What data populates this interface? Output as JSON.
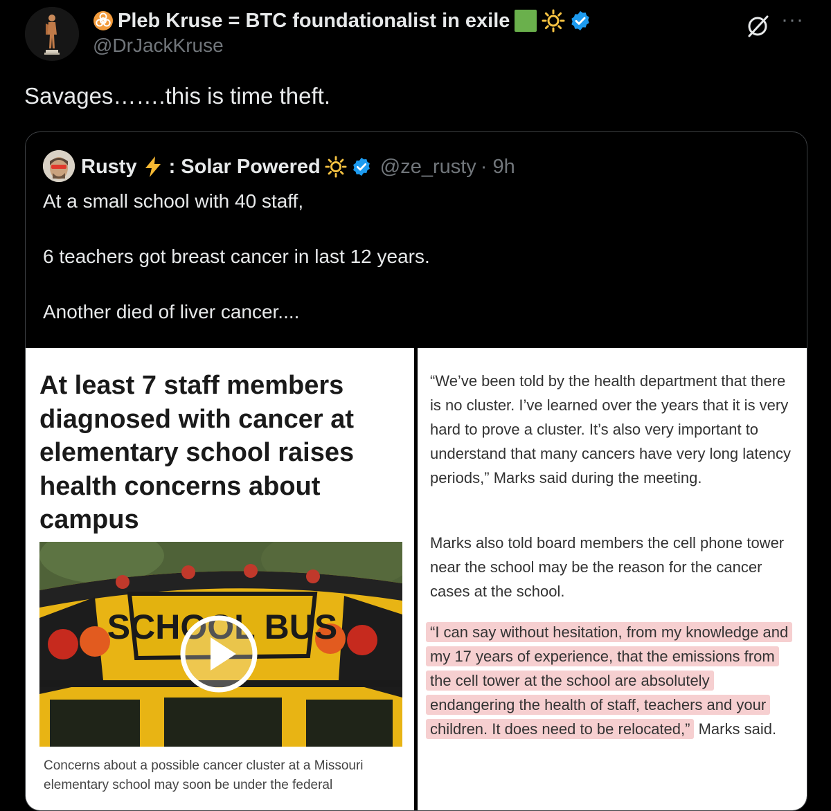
{
  "author": {
    "display_name": "Pleb Kruse = BTC foundationalist in exile",
    "handle": "@DrJackKruse",
    "emoji_icons": [
      "biohazard-icon",
      "green-square-icon",
      "sun-icon"
    ],
    "verified": true
  },
  "tweet": {
    "text": "Savages…….this is time theft."
  },
  "quoted": {
    "author_name": "Rusty",
    "name_suffix": ": Solar Powered",
    "handle": "@ze_rusty",
    "time": "· 9h",
    "lines": [
      "At a small school with 40 staff,",
      "6 teachers got breast cancer in last 12 years.",
      "Another died of liver cancer...."
    ],
    "article_left": {
      "headline": "At least 7 staff members diagnosed with cancer at elementary school raises health concerns about campus",
      "caption": "Concerns about a possible cancer cluster at a Missouri elementary school may soon be under the federal",
      "bus_sign": "SCHOOL BUS"
    },
    "article_right": {
      "para1": "“We’ve been told by the health department that there is no cluster. I’ve learned over the years that it is very hard to prove a cluster. It’s also very important to understand that many cancers have very long latency periods,” Marks said during the meeting.",
      "para2": "Marks also told board members the cell phone tower near the school may be the reason for the cancer cases at the school.",
      "para3_highlight": "“I can say without hesitation, from my knowledge and my 17 years of experience, that the emissions from the cell tower at the school are absolutely endangering the health of staff, teachers and your children. It does need to be relocated,”",
      "para3_rest": " Marks said."
    }
  },
  "colors": {
    "background": "#000000",
    "verified_badge": "#1d9bf0",
    "highlight": "#f6cfd0",
    "secondary_text": "#71767b"
  }
}
